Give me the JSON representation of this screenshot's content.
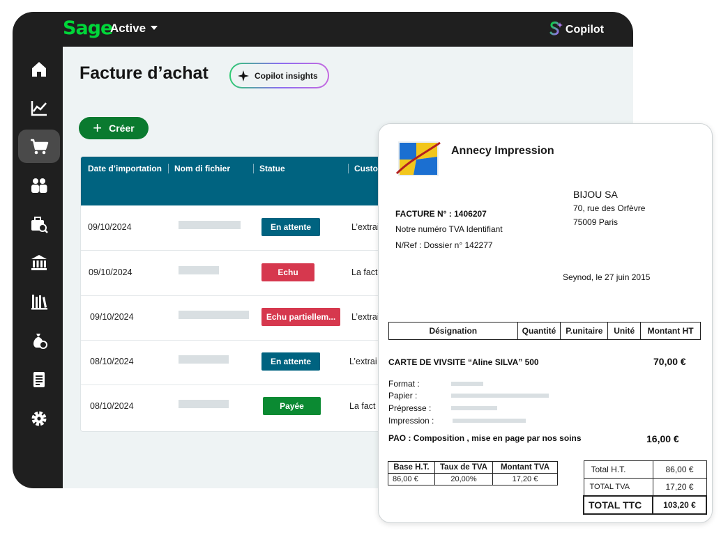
{
  "app": {
    "logo": "Sage",
    "status_filter": "Active",
    "copilot_label": "Copilot"
  },
  "sidebar": {
    "items": [
      {
        "icon": "home-icon"
      },
      {
        "icon": "chart-icon"
      },
      {
        "icon": "cart-icon",
        "active": true
      },
      {
        "icon": "contacts-icon"
      },
      {
        "icon": "briefcase-search-icon"
      },
      {
        "icon": "bank-icon"
      },
      {
        "icon": "books-icon"
      },
      {
        "icon": "money-bag-icon"
      },
      {
        "icon": "document-icon"
      },
      {
        "icon": "gear-icon"
      }
    ]
  },
  "page": {
    "title": "Facture d’achat",
    "insights_label": "Copilot insights",
    "create_label": "Créer"
  },
  "table": {
    "headers": [
      "Date d’importation",
      "Nom di fichier",
      "Statue",
      "Custo"
    ],
    "rows": [
      {
        "date": "09/10/2024",
        "status": "En attente",
        "status_kind": "wait",
        "customer": "L’extrai"
      },
      {
        "date": "09/10/2024",
        "status": "Echu",
        "status_kind": "due",
        "customer": "La fact"
      },
      {
        "date": "09/10/2024",
        "status": "Echu partiellem...",
        "status_kind": "part",
        "customer": "L’extrai"
      },
      {
        "date": "08/10/2024",
        "status": "En attente",
        "status_kind": "wait",
        "customer": "L’extrai"
      },
      {
        "date": "08/10/2024",
        "status": "Payée",
        "status_kind": "paid",
        "customer": "La fact"
      }
    ]
  },
  "invoice": {
    "company": "Annecy Impression",
    "recipient_name": "BIJOU SA",
    "recipient_street": "70, rue des Orfèvre",
    "recipient_city": "75009 Paris",
    "invoice_number": "FACTURE N° : 1406207",
    "vat_line": "Notre numéro TVA Identifiant",
    "ref_line": "N/Ref : Dossier n° 142277",
    "place_date": "Seynod, le 27 juin 2015",
    "columns": [
      "Désignation",
      "Quantité",
      "P.unitaire",
      "Unité",
      "Montant HT"
    ],
    "item1_label": "CARTE DE VIVSITE “Aline SILVA”   500",
    "item1_amount": "70,00 €",
    "details": [
      "Format :",
      "Papier :",
      "Prépresse :",
      "Impression :"
    ],
    "item2_label": "PAO : Composition , mise en page par nos soins",
    "item2_amount": "16,00 €",
    "vat_table": {
      "headers": [
        "Base H.T.",
        "Taux de TVA",
        "Montant TVA"
      ],
      "values": [
        "86,00 €",
        "20,00%",
        "17,20 €"
      ]
    },
    "totals": [
      {
        "label": "Total H.T.",
        "value": "86,00 €"
      },
      {
        "label": "TOTAL TVA",
        "value": "17,20 €"
      },
      {
        "label": "TOTAL TTC",
        "value": "103,20 €"
      }
    ]
  },
  "colors": {
    "brand_green": "#00d639",
    "teal": "#006380",
    "create_green": "#0a7a2f",
    "danger": "#d6384e",
    "paid": "#0b8a32"
  }
}
